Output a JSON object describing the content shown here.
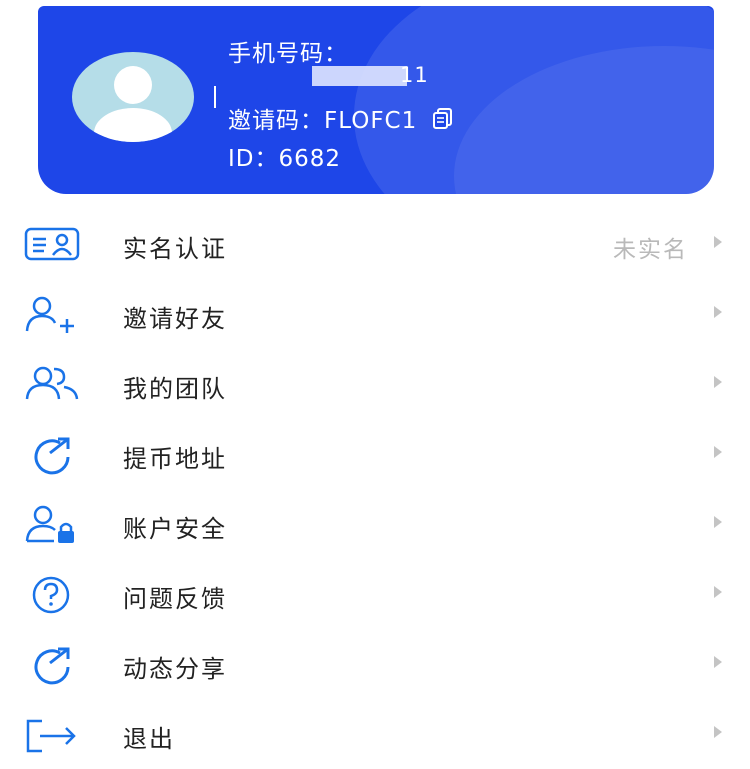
{
  "colors": {
    "accent": "#1e46e8",
    "icon": "#1a73e8",
    "text": "#222222",
    "muted": "#b9b9b9"
  },
  "profile": {
    "phone_label": "手机号码：",
    "phone_value": "11",
    "invite_text": "邀请码：FLOFC1",
    "id_text": "ID：6682"
  },
  "menu": {
    "items": [
      {
        "label": "实名认证",
        "value": "未实名",
        "icon": "id-card-icon"
      },
      {
        "label": "邀请好友",
        "value": "",
        "icon": "add-user-icon"
      },
      {
        "label": "我的团队",
        "value": "",
        "icon": "team-icon"
      },
      {
        "label": "提币地址",
        "value": "",
        "icon": "share-arrow-icon"
      },
      {
        "label": "账户安全",
        "value": "",
        "icon": "user-lock-icon"
      },
      {
        "label": "问题反馈",
        "value": "",
        "icon": "question-icon"
      },
      {
        "label": "动态分享",
        "value": "",
        "icon": "share-arrow-icon"
      },
      {
        "label": "退出",
        "value": "",
        "icon": "logout-icon"
      }
    ]
  }
}
